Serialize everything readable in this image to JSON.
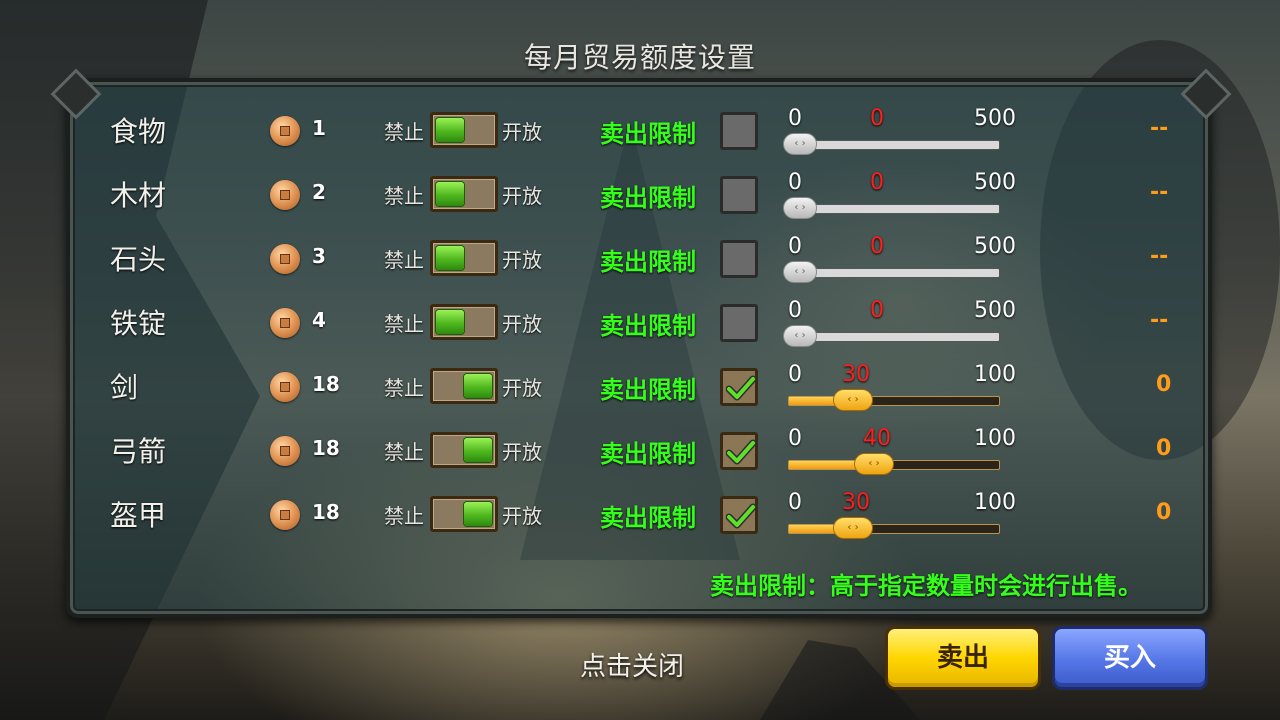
{
  "title": "每月贸易额度设置",
  "toggle_labels": {
    "forbid": "禁止",
    "open": "开放"
  },
  "sell_limit_label": "卖出限制",
  "footer_note": "卖出限制：高于指定数量时会进行出售。",
  "close_text": "点击关闭",
  "buttons": {
    "sell": "卖出",
    "buy": "买入"
  },
  "colors": {
    "sell_limit_green": "#35ff1a",
    "value_red": "#ff1d1d",
    "right_value_orange": "#ff9d1a",
    "sell_button_yellow": "#ffd600",
    "buy_button_blue": "#5476e6"
  },
  "items": [
    {
      "name": "食物",
      "price": "1",
      "toggle": "forbid",
      "checked": false,
      "min": "0",
      "current": "0",
      "max": "500",
      "level": 0,
      "right_value": "--"
    },
    {
      "name": "木材",
      "price": "2",
      "toggle": "forbid",
      "checked": false,
      "min": "0",
      "current": "0",
      "max": "500",
      "level": 0,
      "right_value": "--"
    },
    {
      "name": "石头",
      "price": "3",
      "toggle": "forbid",
      "checked": false,
      "min": "0",
      "current": "0",
      "max": "500",
      "level": 0,
      "right_value": "--"
    },
    {
      "name": "铁锭",
      "price": "4",
      "toggle": "forbid",
      "checked": false,
      "min": "0",
      "current": "0",
      "max": "500",
      "level": 0,
      "right_value": "--"
    },
    {
      "name": "剑",
      "price": "18",
      "toggle": "open",
      "checked": true,
      "min": "0",
      "current": "30",
      "max": "100",
      "level": 0.3,
      "right_value": "0"
    },
    {
      "name": "弓箭",
      "price": "18",
      "toggle": "open",
      "checked": true,
      "min": "0",
      "current": "40",
      "max": "100",
      "level": 0.4,
      "right_value": "0"
    },
    {
      "name": "盔甲",
      "price": "18",
      "toggle": "open",
      "checked": true,
      "min": "0",
      "current": "30",
      "max": "100",
      "level": 0.3,
      "right_value": "0"
    }
  ]
}
